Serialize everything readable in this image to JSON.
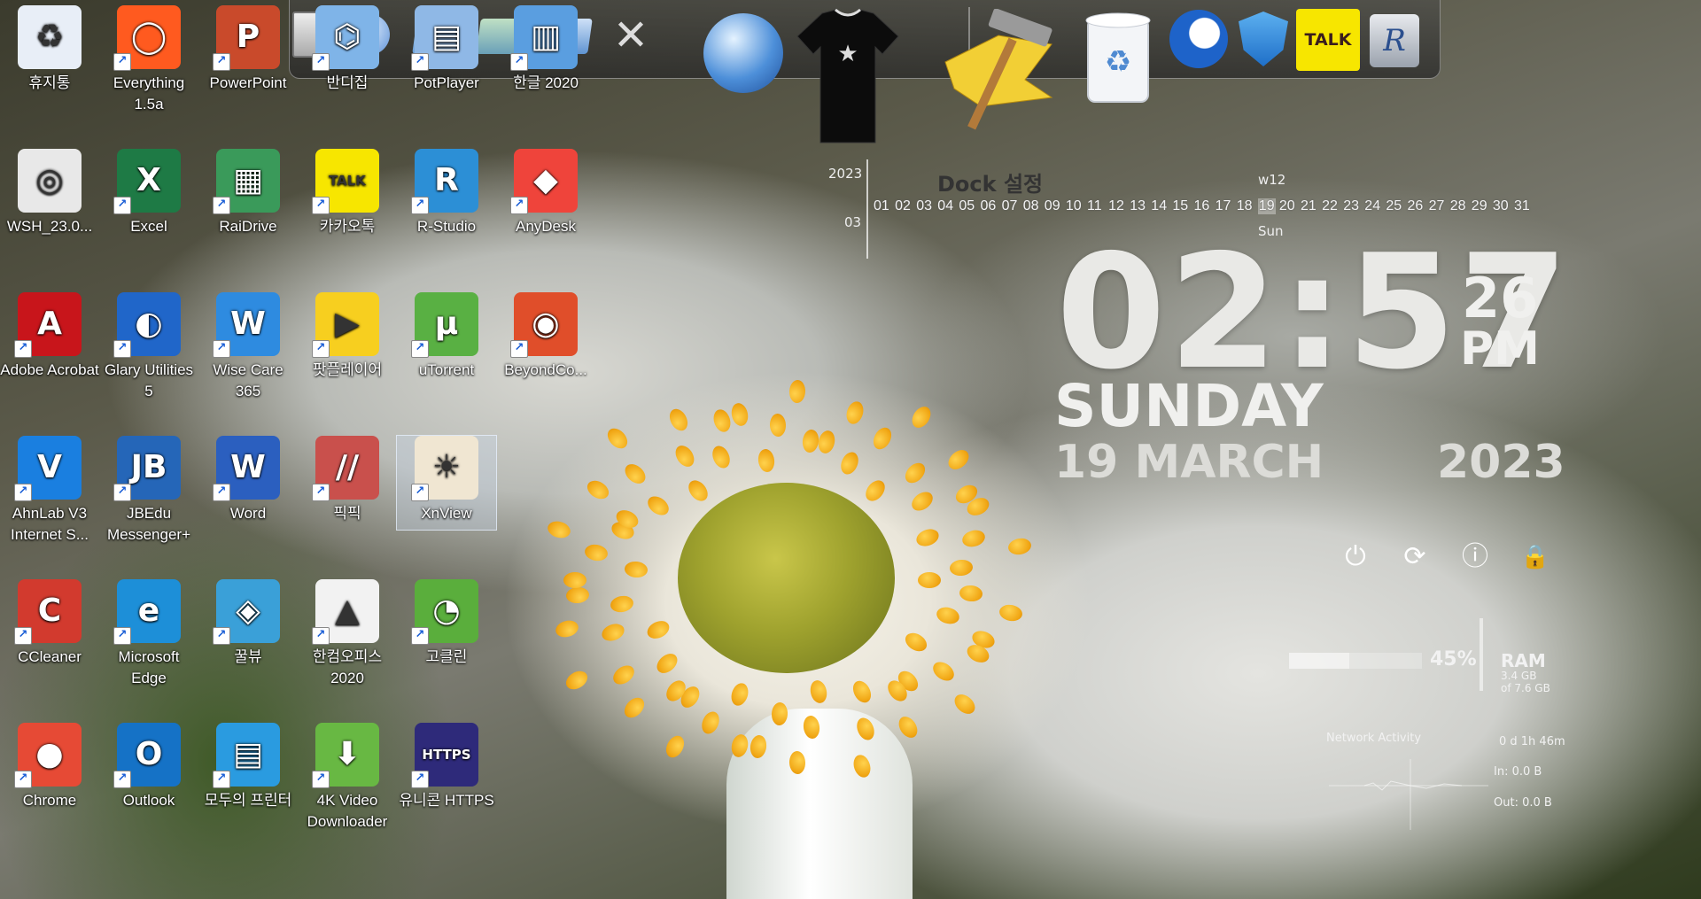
{
  "desktop_icons": [
    {
      "label": "휴지통",
      "color": "#e8eef7"
    },
    {
      "label": "Everything 1.5a",
      "color": "#ff5a1f"
    },
    {
      "label": "PowerPoint",
      "color": "#c94a2b"
    },
    {
      "label": "반디집",
      "color": "#7fb4e8"
    },
    {
      "label": "PotPlayer",
      "color": "#8fb8e6"
    },
    {
      "label": "한글 2020",
      "color": "#5a9ee0"
    },
    {
      "label": "WSH_23.0...",
      "color": "#e8e8e8"
    },
    {
      "label": "Excel",
      "color": "#1e7a45"
    },
    {
      "label": "RaiDrive",
      "color": "#3a9a5a"
    },
    {
      "label": "카카오톡",
      "color": "#f7e600"
    },
    {
      "label": "R-Studio",
      "color": "#2c8fd6"
    },
    {
      "label": "AnyDesk",
      "color": "#ef443b"
    },
    {
      "label": "Adobe Acrobat",
      "color": "#c8151b"
    },
    {
      "label": "Glary Utilities 5",
      "color": "#2066c9"
    },
    {
      "label": "Wise Care 365",
      "color": "#2e8be0"
    },
    {
      "label": "팟플레이어",
      "color": "#f7cf1f"
    },
    {
      "label": "uTorrent",
      "color": "#59b043"
    },
    {
      "label": "BeyondCo...",
      "color": "#e04e2a"
    },
    {
      "label": "AhnLab V3 Internet S...",
      "color": "#1a7fe0"
    },
    {
      "label": "JBEdu Messenger+",
      "color": "#2566b8"
    },
    {
      "label": "Word",
      "color": "#2b5fbf"
    },
    {
      "label": "픽픽",
      "color": "#c9504c"
    },
    {
      "label": "XnView",
      "color": "#f0e6d2"
    },
    {
      "label": "CCleaner",
      "color": "#d23a2e"
    },
    {
      "label": "Microsoft Edge",
      "color": "#1d8fd8"
    },
    {
      "label": "꿀뷰",
      "color": "#3aa0d8"
    },
    {
      "label": "한컴오피스 2020",
      "color": "#f2f2f2"
    },
    {
      "label": "고클린",
      "color": "#5aae3c"
    },
    {
      "label": "Chrome",
      "color": "#e64a35"
    },
    {
      "label": "Outlook",
      "color": "#1572c6"
    },
    {
      "label": "모두의 프린터",
      "color": "#2a9be0"
    },
    {
      "label": "4K Video Downloader",
      "color": "#68b843"
    },
    {
      "label": "유니콘 HTTPS",
      "color": "#2e2a7a"
    }
  ],
  "icon_glyphs": {
    "recycle": "♻",
    "everything": "⚲",
    "ppt": "P",
    "excel": "X",
    "word": "W",
    "kakao": "TALK",
    "anydesk": "◆◆",
    "acrobat": "A",
    "utorrent": "µ",
    "https": "HTTPS",
    "play": "▶"
  },
  "dock": {
    "items": [
      "finder-icon",
      "network-icon",
      "folder-icon",
      "folder-icon",
      "folder-icon",
      "tools-icon",
      "globe-icon",
      "tshirt-icon",
      "hammer-icon",
      "trash-icon",
      "glary-icon",
      "wisecare-icon",
      "kakaotalk-icon",
      "rstudio-icon"
    ],
    "kakao_label": "TALK"
  },
  "calendar": {
    "year": "2023",
    "month": "03",
    "title": "Dock 설정",
    "week": "w12",
    "days": [
      "01",
      "02",
      "03",
      "04",
      "05",
      "06",
      "07",
      "08",
      "09",
      "10",
      "11",
      "12",
      "13",
      "14",
      "15",
      "16",
      "17",
      "18",
      "19",
      "20",
      "21",
      "22",
      "23",
      "24",
      "25",
      "26",
      "27",
      "28",
      "29",
      "30",
      "31"
    ],
    "today": "19",
    "today_label": "Sun"
  },
  "clock": {
    "time": "02:57",
    "seconds": "26",
    "ampm": "PM",
    "day": "SUNDAY",
    "date": "19 MARCH",
    "year": "2023"
  },
  "power_buttons": [
    "⏻",
    "⟳",
    "ⓘ",
    "🔒"
  ],
  "ram": {
    "percent_label": "45%",
    "percent": 45,
    "title": "RAM",
    "used": "3.4 GB",
    "total": "of 7.6 GB"
  },
  "network": {
    "title": "Network Activity",
    "uptime": "0 d 1h 46m",
    "in": "In: 0.0 B",
    "out": "Out: 0.0 B"
  },
  "colors": {
    "dock_bg": "#3c3c3c",
    "clock_text": "#e9e9e6",
    "flower_center": "#9fa22e",
    "stamen": "#f0a513"
  }
}
